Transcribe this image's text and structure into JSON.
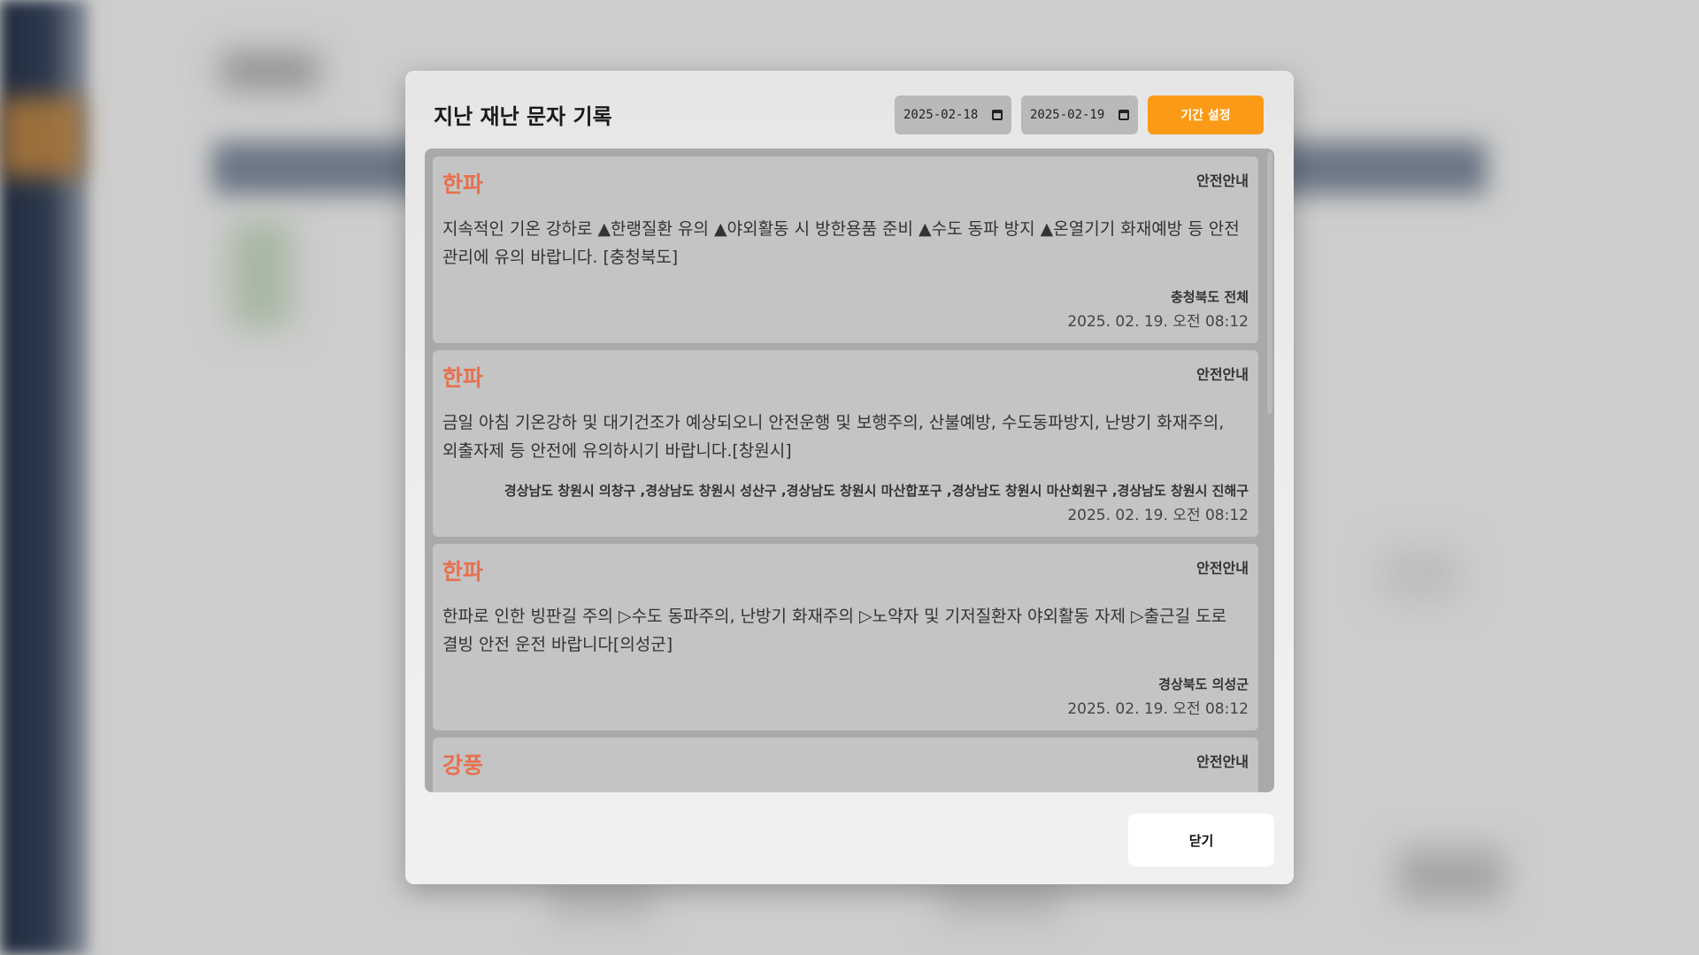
{
  "modal": {
    "title": "지난 재난 문자 기록",
    "date_start": "2025-02-18",
    "date_end": "2025-02-19",
    "set_period_label": "기간 설정",
    "close_label": "닫기"
  },
  "messages": [
    {
      "title": "한파",
      "tag": "안전안내",
      "body": "지속적인 기온 강하로 ▲한랭질환 유의 ▲야외활동 시 방한용품 준비 ▲수도 동파 방지 ▲온열기기 화재예방 등 안전관리에 유의 바랍니다. [충청북도]",
      "region": "충청북도 전체",
      "time": "2025. 02. 19. 오전 08:12"
    },
    {
      "title": "한파",
      "tag": "안전안내",
      "body": "금일 아침 기온강하 및 대기건조가 예상되오니 안전운행 및 보행주의, 산불예방, 수도동파방지, 난방기 화재주의, 외출자제 등 안전에 유의하시기 바랍니다.[창원시]",
      "region": "경상남도 창원시 의창구 ,경상남도 창원시 성산구 ,경상남도 창원시 마산합포구 ,경상남도 창원시 마산회원구 ,경상남도 창원시 진해구",
      "time": "2025. 02. 19. 오전 08:12"
    },
    {
      "title": "한파",
      "tag": "안전안내",
      "body": "한파로 인한 빙판길 주의 ▷수도 동파주의, 난방기 화재주의 ▷노약자 및 기저질환자 야외활동 자제 ▷출근길 도로결빙 안전 운전 바랍니다[의성군]",
      "region": "경상북도 의성군",
      "time": "2025. 02. 19. 오전 08:12"
    },
    {
      "title": "강풍",
      "tag": "안전안내",
      "body": "",
      "region": "",
      "time": ""
    }
  ],
  "colors": {
    "accent": "#fb9a16",
    "title_red": "#e6714f"
  }
}
